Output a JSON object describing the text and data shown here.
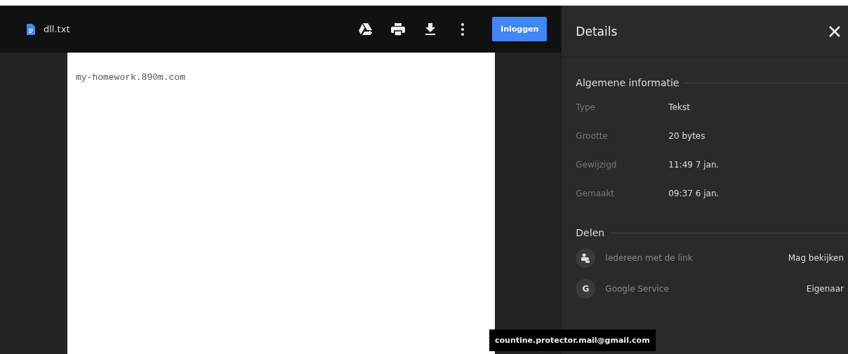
{
  "file": {
    "name": "dll.txt"
  },
  "toolbar": {
    "login_button": "Inloggen"
  },
  "document": {
    "text": "my-homework.890m.com"
  },
  "details": {
    "title": "Details",
    "general": {
      "heading": "Algemene informatie",
      "rows": [
        {
          "label": "Type",
          "value": "Tekst"
        },
        {
          "label": "Grootte",
          "value": "20 bytes"
        },
        {
          "label": "Gewijzigd",
          "value": "11:49 7 jan."
        },
        {
          "label": "Gemaakt",
          "value": "09:37 6 jan."
        }
      ]
    },
    "sharing": {
      "heading": "Delen",
      "rows": [
        {
          "kind": "link",
          "name": "Iedereen met de link",
          "role": "Mag bekijken"
        },
        {
          "kind": "letter",
          "avatar": "G",
          "name": "Google Service",
          "role": "Eigenaar"
        }
      ]
    }
  },
  "tooltip": "countine.protector.mail@gmail.com"
}
